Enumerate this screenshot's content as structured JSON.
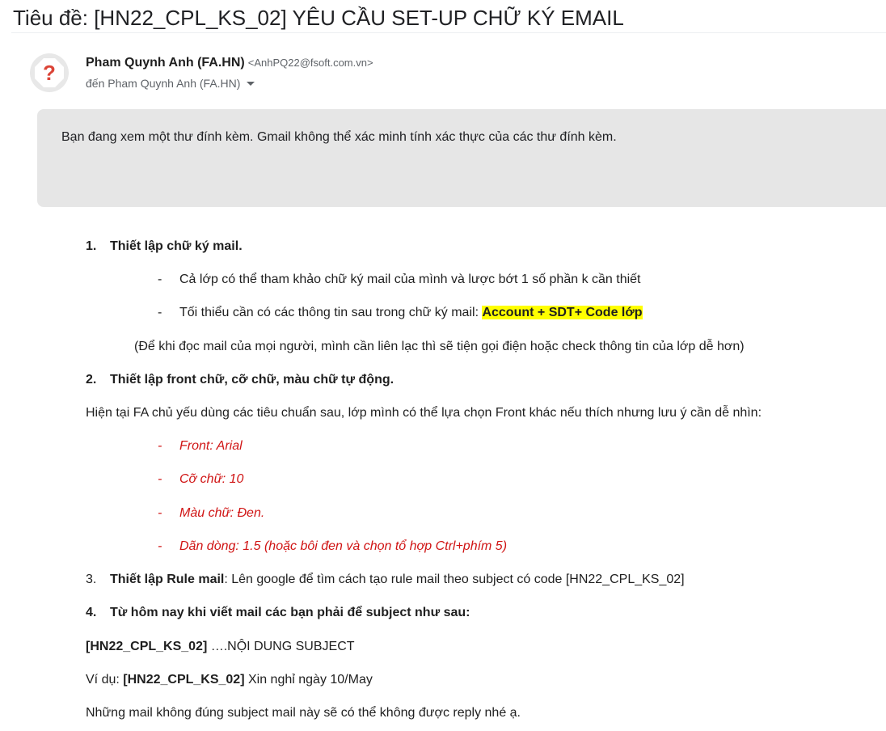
{
  "email": {
    "subject": "Tiêu đề: [HN22_CPL_KS_02] YÊU CẦU SET-UP CHỮ KÝ EMAIL",
    "sender": {
      "name": "Pham Quynh Anh (FA.HN)",
      "email": "<AnhPQ22@fsoft.com.vn>",
      "avatar_glyph": "?"
    },
    "recipient": "đến Pham Quynh Anh (FA.HN)",
    "notice": "Bạn đang xem một thư đính kèm. Gmail không thể xác minh tính xác thực của các thư đính kèm."
  },
  "content": {
    "section1": {
      "number": "1.",
      "title": "Thiết lập chữ ký mail.",
      "bullet_marker": "-",
      "bullet1": "Cả lớp có thể tham khảo chữ ký mail của mình và lược bớt 1 số phần k cần thiết",
      "bullet2_prefix": "Tối thiểu cần có các thông tin sau trong chữ ký mail: ",
      "bullet2_highlight": "Account + SDT+ Code lớp",
      "note": "(Để khi đọc mail của mọi người, mình cần liên lạc thì sẽ tiện gọi điện hoặc check thông tin của lớp dễ hơn)"
    },
    "section2": {
      "number": "2.",
      "title": "Thiết lập front chữ, cỡ chữ, màu chữ tự động.",
      "intro": "Hiện tại FA chủ yếu dùng các tiêu chuẩn sau, lớp mình có thể lựa chọn Front khác nếu thích nhưng lưu ý cần dễ nhìn:",
      "items": [
        "Front: Arial",
        "Cỡ chữ: 10",
        "Màu chữ: Đen.",
        "Dãn dòng: 1.5 (hoặc bôi đen và chọn tổ hợp Ctrl+phím 5)"
      ]
    },
    "section3": {
      "number": "3.",
      "title": "Thiết lập Rule mail",
      "text": ": Lên google để tìm cách tạo rule mail theo subject có code [HN22_CPL_KS_02]"
    },
    "section4": {
      "number": "4.",
      "title": "Từ hôm nay khi viết mail các bạn phải để subject như sau:",
      "format_code": "[HN22_CPL_KS_02]",
      "format_rest": " ….NỘI DUNG SUBJECT",
      "example_prefix": "Ví dụ: ",
      "example_code": "[HN22_CPL_KS_02]",
      "example_rest": " Xin nghỉ ngày 10/May",
      "closing": "Những mail không đúng subject mail này sẽ có thể không được reply nhé ạ."
    }
  },
  "colors": {
    "avatar_icon": "#db4437",
    "warning_text": "#d01414",
    "highlight": "#ffff00"
  }
}
